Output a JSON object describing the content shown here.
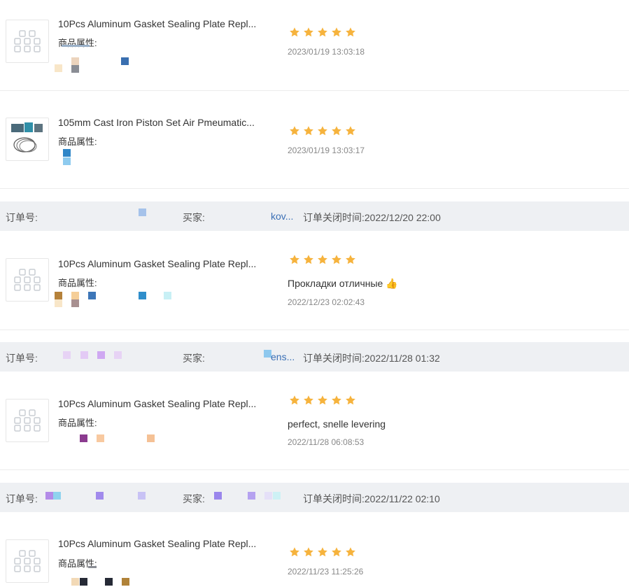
{
  "labels": {
    "attr": "商品属性:",
    "order_no": "订单号:",
    "buyer": "买家:"
  },
  "colors": {
    "star": "#f6b33d",
    "bar_bg": "#eef0f3",
    "date": "#888888"
  },
  "items": [
    {
      "title": "10Pcs Aluminum Gasket Sealing Plate Repl...",
      "date": "2023/01/19 13:03:18",
      "comment": "",
      "rating": 5,
      "image": "gasket-placeholder-icon"
    },
    {
      "title": "105mm Cast Iron Piston Set Air Pmeumatic...",
      "date": "2023/01/19 13:03:17",
      "comment": "",
      "rating": 5,
      "image": "piston-photo"
    },
    {
      "title": "10Pcs Aluminum Gasket Sealing Plate Repl...",
      "date": "2022/12/23 02:02:43",
      "comment": "Прокладки отличные 👍",
      "rating": 5,
      "image": "gasket-placeholder-icon"
    },
    {
      "title": "10Pcs Aluminum Gasket Sealing Plate Repl...",
      "date": "2022/11/28 06:08:53",
      "comment": "perfect, snelle levering",
      "rating": 5,
      "image": "gasket-placeholder-icon"
    },
    {
      "title": "10Pcs Aluminum Gasket Sealing Plate Repl...",
      "date": "2022/11/23 11:25:26",
      "comment": "",
      "rating": 5,
      "image": "gasket-placeholder-icon"
    }
  ],
  "orders": [
    {
      "closed_time": "订单关闭时间:2022/12/20 22:00",
      "buyer_tail": "kov..."
    },
    {
      "closed_time": "订单关闭时间:2022/11/28 01:32",
      "buyer_tail": "ens..."
    },
    {
      "closed_time": "订单关闭时间:2022/11/22 02:10",
      "buyer_tail": ""
    }
  ]
}
